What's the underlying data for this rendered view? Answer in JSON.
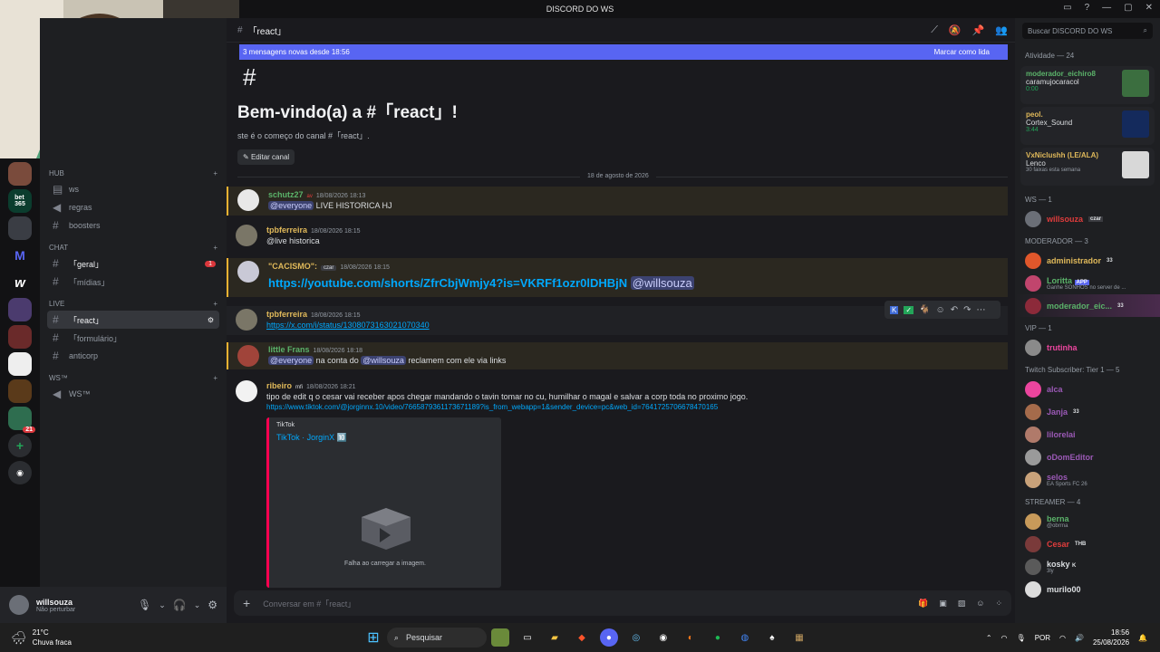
{
  "window": {
    "title": "DISCORD DO WS"
  },
  "channel": {
    "name": "「react」",
    "new_messages_banner": "3 mensagens novas desde 18:56",
    "mark_read": "Marcar como lida",
    "welcome_title": "Bem-vindo(a) a #「react」!",
    "welcome_sub": "ste é o começo do canal #「react」.",
    "edit_channel": "Editar canal",
    "date_divider": "18 de agosto de 2026",
    "composer_placeholder": "Conversar em #「react」"
  },
  "sidebar": {
    "categories": [
      {
        "label": "HUB",
        "channels": [
          {
            "label": "ws"
          },
          {
            "label": "regras"
          },
          {
            "label": "boosters"
          }
        ]
      },
      {
        "label": "CHAT",
        "channels": [
          {
            "label": "「geral」",
            "badge": "1"
          },
          {
            "label": "「mídias」"
          }
        ]
      },
      {
        "label": "LIVE",
        "channels": [
          {
            "label": "「react」"
          },
          {
            "label": "「formulário」"
          },
          {
            "label": "anticorp"
          }
        ]
      },
      {
        "label": "WS™",
        "channels": [
          {
            "label": "WS™"
          }
        ]
      }
    ]
  },
  "user": {
    "name": "willsouza",
    "status": "Não perturbar"
  },
  "messages": [
    {
      "author": "schutz27",
      "tag": "av",
      "time": "18/08/2026 18:13",
      "mention": "@everyone",
      "text": " LIVE HISTORICA HJ",
      "color": "#5bb36a"
    },
    {
      "author": "tpbferreira",
      "time": "18/08/2026 18:15",
      "text": "@live historica",
      "color": "#e0b95a"
    },
    {
      "author": "\"CACISMO\":",
      "tag": "czar",
      "time": "18/08/2026 18:15",
      "link": "https://youtube.com/shorts/ZfrCbjWmjy4?is=VKRFf1ozr0lDHBjN",
      "mention": "@willsouza",
      "color": "#e0b95a"
    },
    {
      "author": "tpbferreira",
      "time": "18/08/2026 18:15",
      "link": "https://x.com/i/status/1308073163021070340",
      "color": "#e0b95a"
    },
    {
      "author": "little Frans",
      "time": "18/08/2026 18:18",
      "mention": "@everyone",
      "text": " na conta do ",
      "mention2": "@willsouza",
      "text2": " reclamem com ele via links",
      "color": "#5bb36a"
    },
    {
      "author": "ribeiro",
      "tag": "mfi",
      "time": "18/08/2026 18:21",
      "text": "tipo de edit q o cesar vai receber apos chegar mandando o tavin tomar no cu, humilhar o magal e salvar a corp toda no proximo jogo.",
      "link": "https://www.tiktok.com/@jorginnx.10/video/7665879361173671189?is_from_webapp=1&sender_device=pc&web_id=7641725706678470165",
      "color": "#e0b95a"
    }
  ],
  "embed": {
    "provider": "TikTok",
    "title": "TikTok · JorginX 🔟",
    "error": "Falha ao carregar a imagem."
  },
  "members": {
    "search_placeholder": "Buscar DISCORD DO WS",
    "activity_header": "Atividade — 24",
    "activities": [
      {
        "user": "moderador_eichiro8",
        "track": "caramujocaracol",
        "meta": "0:00",
        "color": "#5bb36a"
      },
      {
        "user": "peol.",
        "track": "Cortex_Sound",
        "meta": "3:44",
        "color": "#e0b95a"
      },
      {
        "user": "VxNiclushh (LE/ALA)",
        "track": "Lenco",
        "meta": "30 faixas esta semana",
        "color": "#e0b95a"
      }
    ],
    "groups": [
      {
        "label": "WS — 1",
        "items": [
          {
            "name": "willsouza",
            "tag": "czar",
            "color": "#e03c3c"
          }
        ]
      },
      {
        "label": "MODERADOR — 3",
        "items": [
          {
            "name": "administrador",
            "tag": "33",
            "color": "#e0b95a"
          },
          {
            "name": "Loritta",
            "tag": "APP",
            "sub": "Ganhe SONHOS no server de ...",
            "color": "#5bb36a"
          },
          {
            "name": "moderador_eic...",
            "tag": "33",
            "color": "#5bb36a"
          }
        ]
      },
      {
        "label": "VIP — 1",
        "items": [
          {
            "name": "trutinha",
            "color": "#eb459e"
          }
        ]
      },
      {
        "label": "Twitch Subscriber: Tier 1 — 5",
        "items": [
          {
            "name": "alca",
            "color": "#9b59b6"
          },
          {
            "name": "Janja",
            "tag": "33",
            "color": "#9b59b6"
          },
          {
            "name": "lilorelai",
            "color": "#9b59b6"
          },
          {
            "name": "oDomEditor",
            "color": "#9b59b6"
          },
          {
            "name": "selos",
            "sub": "EA Sports FC 26",
            "color": "#9b59b6"
          }
        ]
      },
      {
        "label": "STREAMER — 4",
        "items": [
          {
            "name": "berna",
            "sub": "@obrrna",
            "color": "#5bb36a"
          },
          {
            "name": "Cesar",
            "tag": "THB",
            "color": "#e03c3c"
          },
          {
            "name": "kosky",
            "tag": "K",
            "sub": "3ly",
            "color": "#dbdee1"
          },
          {
            "name": "murilo00",
            "color": "#dbdee1"
          }
        ]
      }
    ]
  },
  "taskbar": {
    "weather_temp": "21°C",
    "weather_desc": "Chuva fraca",
    "search": "Pesquisar",
    "lang": "POR",
    "time": "18:56",
    "date": "25/08/2026"
  }
}
